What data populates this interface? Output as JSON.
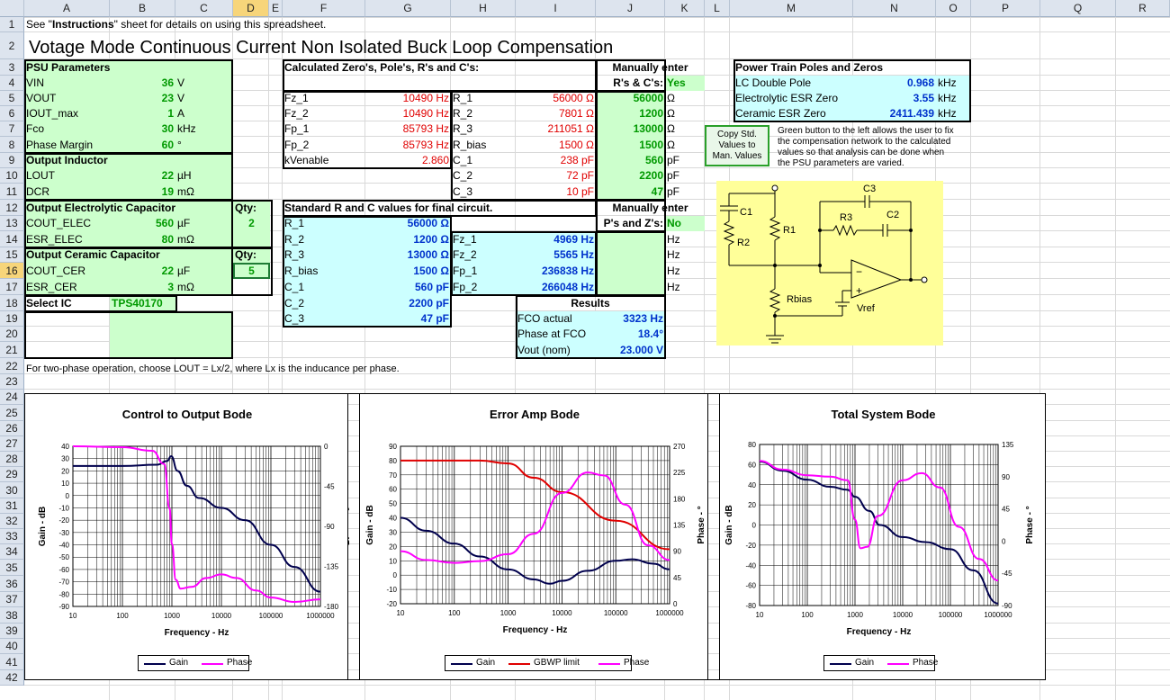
{
  "columns": [
    "A",
    "B",
    "C",
    "D",
    "E",
    "F",
    "G",
    "H",
    "I",
    "J",
    "K",
    "L",
    "M",
    "N",
    "O",
    "P",
    "Q",
    "R"
  ],
  "rows": [
    "1",
    "2",
    "3",
    "4",
    "5",
    "6",
    "7",
    "8",
    "9",
    "10",
    "11",
    "12",
    "13",
    "14",
    "15",
    "16",
    "17",
    "18",
    "19",
    "20",
    "21",
    "22",
    "23",
    "24",
    "25",
    "26",
    "27",
    "28",
    "29",
    "30",
    "31",
    "32",
    "33",
    "34",
    "35",
    "36",
    "37",
    "38",
    "39",
    "40",
    "41",
    "42"
  ],
  "selected_column": "D",
  "selected_row": "16",
  "row1_text": {
    "pre": "See \"",
    "bold": "Instructions",
    "post": "\" sheet for details on using this spreadsheet."
  },
  "title": "Votage Mode Continuous Current Non Isolated Buck Loop Compensation",
  "psu": {
    "header": "PSU Parameters",
    "rows": [
      {
        "label": "VIN",
        "value": "36",
        "unit": "V"
      },
      {
        "label": "VOUT",
        "value": "23",
        "unit": "V"
      },
      {
        "label": "IOUT_max",
        "value": "1",
        "unit": "A"
      },
      {
        "label": "Fco",
        "value": "30",
        "unit": "kHz"
      },
      {
        "label": "Phase Margin",
        "value": "60",
        "unit": "°"
      }
    ],
    "inductor_header": "Output Inductor",
    "inductor": [
      {
        "label": "LOUT",
        "value": "22",
        "unit": "µH"
      },
      {
        "label": "DCR",
        "value": "19",
        "unit": "mΩ"
      }
    ],
    "elec_header": "Output Electrolytic Capacitor",
    "elec_qty_label": "Qty:",
    "elec_qty": "2",
    "elec": [
      {
        "label": "COUT_ELEC",
        "value": "560",
        "unit": "µF"
      },
      {
        "label": "ESR_ELEC",
        "value": "80",
        "unit": "mΩ"
      }
    ],
    "cer_header": "Output Ceramic Capacitor",
    "cer_qty_label": "Qty:",
    "cer_qty": "5",
    "cer": [
      {
        "label": "COUT_CER",
        "value": "22",
        "unit": "µF"
      },
      {
        "label": "ESR_CER",
        "value": "3",
        "unit": "mΩ"
      }
    ],
    "ic_label": "Select IC",
    "ic_value": "TPS40170"
  },
  "calc": {
    "header": "Calculated Zero's, Pole's, R's and C's:",
    "manual_header1": "Manually enter",
    "manual_header2": "R's & C's:",
    "manual_flag": "Yes",
    "rows": [
      {
        "l": "Fz_1",
        "v": "10490 Hz",
        "l2": "R_1",
        "v2": "56000 Ω",
        "m": "56000",
        "u": "Ω"
      },
      {
        "l": "Fz_2",
        "v": "10490 Hz",
        "l2": "R_2",
        "v2": "7801 Ω",
        "m": "1200",
        "u": "Ω"
      },
      {
        "l": "Fp_1",
        "v": "85793 Hz",
        "l2": "R_3",
        "v2": "211051 Ω",
        "m": "13000",
        "u": "Ω"
      },
      {
        "l": "Fp_2",
        "v": "85793 Hz",
        "l2": "R_bias",
        "v2": "1500 Ω",
        "m": "1500",
        "u": "Ω"
      },
      {
        "l": "kVenable",
        "v": "2.860",
        "l2": "C_1",
        "v2": "238 pF",
        "m": "560",
        "u": "pF"
      },
      {
        "l": "",
        "v": "",
        "l2": "C_2",
        "v2": "72 pF",
        "m": "2200",
        "u": "pF"
      },
      {
        "l": "",
        "v": "",
        "l2": "C_3",
        "v2": "10 pF",
        "m": "47",
        "u": "pF"
      }
    ]
  },
  "std": {
    "header": "Standard R and C values for final circuit.",
    "manual_header1": "Manually enter",
    "manual_header2": "P's and Z's:",
    "manual_flag": "No",
    "rows": [
      {
        "l": "R_1",
        "v": "56000 Ω",
        "l2": "",
        "v2": "",
        "u": ""
      },
      {
        "l": "R_2",
        "v": "1200 Ω",
        "l2": "Fz_1",
        "v2": "4969 Hz",
        "u": "Hz"
      },
      {
        "l": "R_3",
        "v": "13000 Ω",
        "l2": "Fz_2",
        "v2": "5565 Hz",
        "u": "Hz"
      },
      {
        "l": "R_bias",
        "v": "1500 Ω",
        "l2": "Fp_1",
        "v2": "236838 Hz",
        "u": "Hz"
      },
      {
        "l": "C_1",
        "v": "560 pF",
        "l2": "Fp_2",
        "v2": "266048 Hz",
        "u": "Hz"
      },
      {
        "l": "C_2",
        "v": "2200 pF",
        "l2": "",
        "v2": "",
        "u": ""
      },
      {
        "l": "C_3",
        "v": "47 pF",
        "l2": "",
        "v2": "",
        "u": ""
      }
    ]
  },
  "results": {
    "header": "Results",
    "rows": [
      {
        "l": "FCO actual",
        "v": "3323 Hz"
      },
      {
        "l": "Phase at FCO",
        "v": "18.4°"
      },
      {
        "l": "Vout (nom)",
        "v": "23.000 V"
      }
    ]
  },
  "power_train": {
    "header": "Power Train Poles and Zeros",
    "rows": [
      {
        "l": "LC Double Pole",
        "v": "0.968",
        "u": "kHz"
      },
      {
        "l": "Electrolytic ESR Zero",
        "v": "3.55",
        "u": "kHz"
      },
      {
        "l": "Ceramic ESR Zero",
        "v": "2411.439",
        "u": "kHz"
      }
    ]
  },
  "copy_button": {
    "line1": "Copy Std.",
    "line2": "Values to",
    "line3": "Man. Values"
  },
  "copy_note": [
    "Green button to the left allows the user to fix",
    "the compensation network to the calculated",
    "values so that analysis can be done when",
    "the PSU  parameters are varied."
  ],
  "schematic_labels": {
    "c1": "C1",
    "r1": "R1",
    "r2": "R2",
    "r3": "R3",
    "c2": "C2",
    "c3": "C3",
    "rbias": "Rbias",
    "vref": "Vref",
    "minus": "−",
    "plus": "+"
  },
  "note22": "For two-phase operation, choose LOUT = Lx/2, where Lx is the inducance per phase.",
  "colors": {
    "gain": "#00004d",
    "phase": "#ff00ff",
    "gbwp": "#e00000",
    "green": "#ccffcc",
    "cyan": "#ccffff",
    "schematic_bg": "#ffff99"
  },
  "chart_data": [
    {
      "type": "line",
      "title": "Control to Output Bode",
      "xlabel": "Frequency - Hz",
      "ylabel": "Gain - dB",
      "y2label": "Phase - °",
      "x_scale": "log",
      "xlim": [
        10,
        1000000
      ],
      "ylim": [
        -90,
        40
      ],
      "y2lim": [
        -180,
        0
      ],
      "xticks": [
        "10",
        "100",
        "1000",
        "10000",
        "100000",
        "1000000"
      ],
      "yticks": [
        "40",
        "30",
        "20",
        "10",
        "0",
        "-10",
        "-20",
        "-30",
        "-40",
        "-50",
        "-60",
        "-70",
        "-80",
        "-90"
      ],
      "y2ticks": [
        "0",
        "-45",
        "-90",
        "-135",
        "-180"
      ],
      "series": [
        {
          "name": "Gain",
          "axis": "left",
          "points": [
            [
              10,
              24
            ],
            [
              100,
              24
            ],
            [
              500,
              25
            ],
            [
              800,
              28
            ],
            [
              968,
              32
            ],
            [
              1300,
              20
            ],
            [
              2000,
              8
            ],
            [
              3550,
              -2
            ],
            [
              10000,
              -10
            ],
            [
              30000,
              -20
            ],
            [
              100000,
              -40
            ],
            [
              300000,
              -58
            ],
            [
              1000000,
              -78
            ]
          ]
        },
        {
          "name": "Phase",
          "axis": "right",
          "points": [
            [
              10,
              0
            ],
            [
              100,
              -1
            ],
            [
              400,
              -5
            ],
            [
              700,
              -20
            ],
            [
              900,
              -70
            ],
            [
              1000,
              -110
            ],
            [
              1200,
              -150
            ],
            [
              1500,
              -160
            ],
            [
              2500,
              -158
            ],
            [
              5000,
              -148
            ],
            [
              10000,
              -144
            ],
            [
              20000,
              -148
            ],
            [
              50000,
              -162
            ],
            [
              100000,
              -170
            ],
            [
              300000,
              -175
            ],
            [
              1000000,
              -172
            ]
          ]
        }
      ],
      "legend": [
        "Gain",
        "Phase"
      ],
      "legend_position": "bottom"
    },
    {
      "type": "line",
      "title": "Error Amp Bode",
      "xlabel": "Frequency - Hz",
      "ylabel": "Gain - dB",
      "y2label": "Phase - °",
      "x_scale": "log",
      "xlim": [
        10,
        1000000
      ],
      "ylim": [
        -20,
        90
      ],
      "y2lim": [
        0,
        270
      ],
      "xticks": [
        "10",
        "100",
        "1000",
        "10000",
        "100000",
        "1000000"
      ],
      "yticks": [
        "90",
        "80",
        "70",
        "60",
        "50",
        "40",
        "30",
        "20",
        "10",
        "0",
        "-10",
        "-20"
      ],
      "y2ticks": [
        "270",
        "225",
        "180",
        "135",
        "90",
        "45",
        "0"
      ],
      "series": [
        {
          "name": "Gain",
          "axis": "left",
          "points": [
            [
              10,
              40
            ],
            [
              30,
              31
            ],
            [
              100,
              22
            ],
            [
              300,
              13
            ],
            [
              1000,
              4
            ],
            [
              3000,
              -3
            ],
            [
              6000,
              -6
            ],
            [
              10000,
              -4
            ],
            [
              30000,
              3
            ],
            [
              100000,
              10
            ],
            [
              200000,
              11
            ],
            [
              500000,
              8
            ],
            [
              1000000,
              4
            ]
          ]
        },
        {
          "name": "GBWP limit",
          "axis": "left",
          "points": [
            [
              10,
              80
            ],
            [
              300,
              80
            ],
            [
              1000,
              78
            ],
            [
              3000,
              68
            ],
            [
              10000,
              58
            ],
            [
              100000,
              38
            ],
            [
              1000000,
              18
            ]
          ]
        },
        {
          "name": "Phase",
          "axis": "right",
          "points": [
            [
              10,
              90
            ],
            [
              30,
              75
            ],
            [
              100,
              70
            ],
            [
              300,
              73
            ],
            [
              1000,
              85
            ],
            [
              3000,
              120
            ],
            [
              10000,
              190
            ],
            [
              30000,
              225
            ],
            [
              60000,
              220
            ],
            [
              150000,
              170
            ],
            [
              400000,
              100
            ],
            [
              1000000,
              75
            ]
          ]
        }
      ],
      "legend": [
        "Gain",
        "GBWP limit",
        "Phase"
      ],
      "legend_position": "bottom"
    },
    {
      "type": "line",
      "title": "Total System Bode",
      "xlabel": "Frequency - Hz",
      "ylabel": "Gain - dB",
      "y2label": "Phase - °",
      "x_scale": "log",
      "xlim": [
        10,
        1000000
      ],
      "ylim": [
        -80,
        80
      ],
      "y2lim": [
        -90,
        135
      ],
      "xticks": [
        "10",
        "100",
        "1000",
        "10000",
        "100000",
        "1000000"
      ],
      "yticks": [
        "80",
        "60",
        "40",
        "20",
        "0",
        "-20",
        "-40",
        "-60",
        "-80"
      ],
      "y2ticks": [
        "135",
        "90",
        "45",
        "0",
        "-45",
        "-90"
      ],
      "series": [
        {
          "name": "Gain",
          "axis": "left",
          "points": [
            [
              10,
              63
            ],
            [
              30,
              54
            ],
            [
              100,
              45
            ],
            [
              300,
              38
            ],
            [
              700,
              35
            ],
            [
              1000,
              28
            ],
            [
              2000,
              14
            ],
            [
              3323,
              0
            ],
            [
              10000,
              -12
            ],
            [
              30000,
              -17
            ],
            [
              100000,
              -24
            ],
            [
              300000,
              -45
            ],
            [
              1000000,
              -78
            ]
          ]
        },
        {
          "name": "Phase",
          "axis": "right",
          "points": [
            [
              10,
              112
            ],
            [
              30,
              100
            ],
            [
              100,
              92
            ],
            [
              300,
              90
            ],
            [
              700,
              85
            ],
            [
              1000,
              30
            ],
            [
              1300,
              -10
            ],
            [
              1800,
              -8
            ],
            [
              3000,
              35
            ],
            [
              10000,
              85
            ],
            [
              25000,
              95
            ],
            [
              60000,
              75
            ],
            [
              150000,
              20
            ],
            [
              400000,
              -25
            ],
            [
              1000000,
              -55
            ]
          ]
        }
      ],
      "legend": [
        "Gain",
        "Phase"
      ],
      "legend_position": "bottom"
    }
  ]
}
